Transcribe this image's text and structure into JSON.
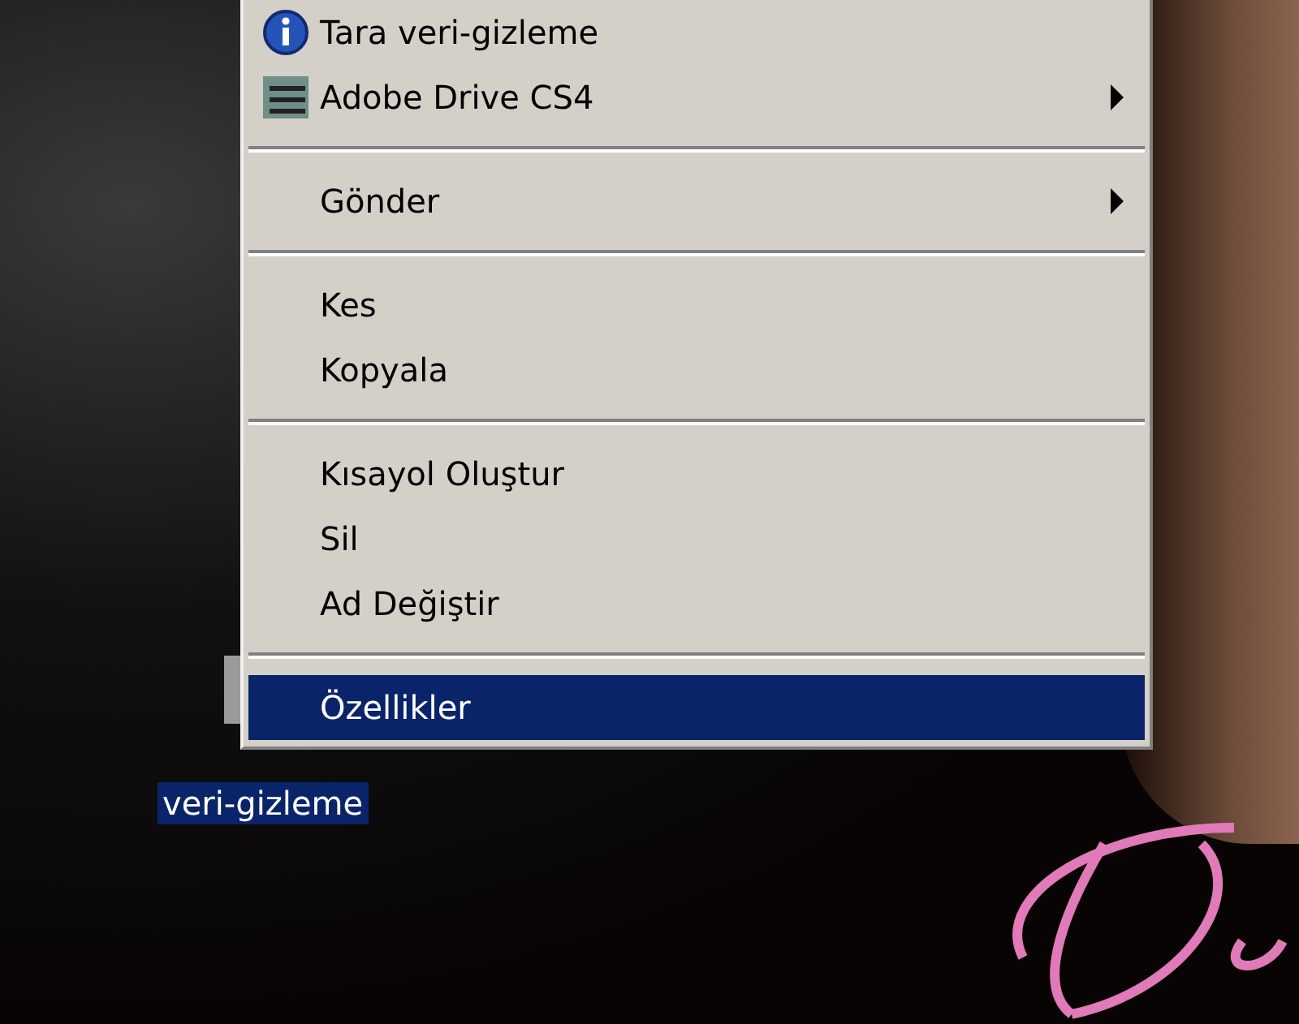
{
  "context_menu": {
    "items": [
      {
        "kind": "icon-item",
        "label": "Tara veri-gizleme",
        "submenu": false,
        "selected": false
      },
      {
        "kind": "icon-item",
        "label": "Adobe Drive CS4",
        "submenu": true,
        "selected": false
      },
      {
        "kind": "separator"
      },
      {
        "kind": "item",
        "label": "Gönder",
        "submenu": true,
        "selected": false
      },
      {
        "kind": "separator"
      },
      {
        "kind": "item",
        "label": "Kes",
        "submenu": false,
        "selected": false
      },
      {
        "kind": "item",
        "label": "Kopyala",
        "submenu": false,
        "selected": false
      },
      {
        "kind": "separator"
      },
      {
        "kind": "item",
        "label": "Kısayol Oluştur",
        "submenu": false,
        "selected": false
      },
      {
        "kind": "item",
        "label": "Sil",
        "submenu": false,
        "selected": false
      },
      {
        "kind": "item",
        "label": "Ad Değiştir",
        "submenu": false,
        "selected": false
      },
      {
        "kind": "separator"
      },
      {
        "kind": "item",
        "label": "Özellikler",
        "submenu": false,
        "selected": true
      }
    ]
  },
  "desktop_icon": {
    "label": "veri-gizleme",
    "selected": true
  }
}
